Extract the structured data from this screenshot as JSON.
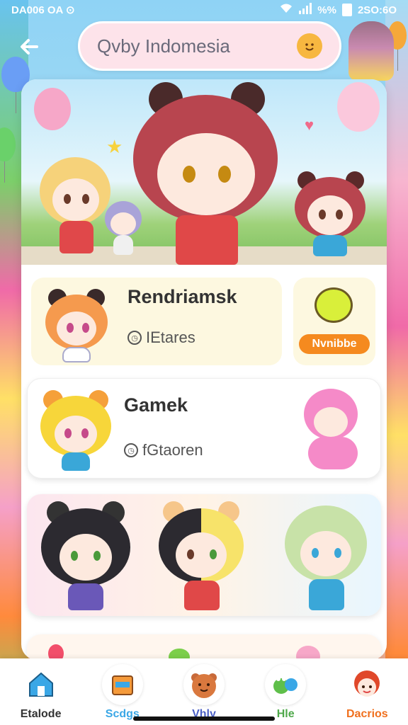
{
  "status_bar": {
    "left_text": "DA006 OA ⊙",
    "right_text": "2SO:6O",
    "signal_text": "%%"
  },
  "header": {
    "search_text": "Qvby Indomesia",
    "back_icon": "back-arrow-icon",
    "smiley_icon": "smiley-icon"
  },
  "cards": [
    {
      "title": "Rendriamsk",
      "subtitle": "IEtares",
      "tag": "Nvnibbe"
    },
    {
      "title": "Gamek",
      "subtitle": "fGtaoren"
    }
  ],
  "bottom_nav": [
    {
      "label": "Etalode",
      "icon": "home-icon",
      "color": "#333333"
    },
    {
      "label": "Scdgs",
      "icon": "bag-icon",
      "color": "#3aa7e6"
    },
    {
      "label": "Vhly",
      "icon": "bear-face-icon",
      "color": "#4a5fc6"
    },
    {
      "label": "Hle",
      "icon": "frog-icon",
      "color": "#4fa84a"
    },
    {
      "label": "Dacrios",
      "icon": "character-icon",
      "color": "#f0701e"
    }
  ]
}
